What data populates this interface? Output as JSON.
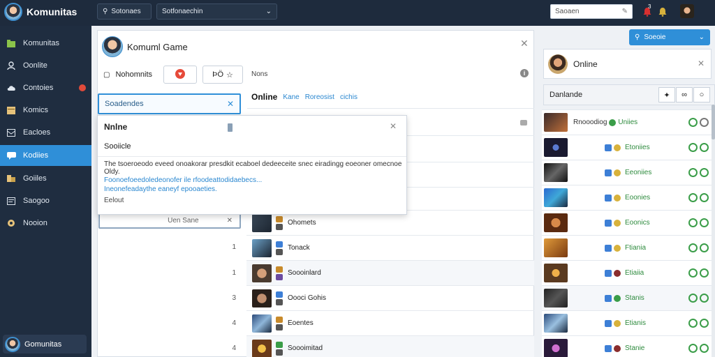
{
  "app": {
    "title": "Komunitas"
  },
  "topbar": {
    "search_label": "Sotonaes",
    "select_label": "Sotfonaechin",
    "input_value": "Saoaen",
    "notify_badge": "3",
    "colors": {
      "bg": "#1e2b3d",
      "accent": "#2f8fd8"
    }
  },
  "sidebar": {
    "items": [
      {
        "label": "Komunitas",
        "icon": "folder-icon"
      },
      {
        "label": "Oonlite",
        "icon": "user-icon"
      },
      {
        "label": "Contoies",
        "icon": "cloud-icon"
      },
      {
        "label": "Komics",
        "icon": "grid-icon"
      },
      {
        "label": "Eacloes",
        "icon": "inbox-icon"
      },
      {
        "label": "Kodiies",
        "icon": "chat-icon"
      },
      {
        "label": "Goiiles",
        "icon": "pin-icon"
      },
      {
        "label": "Saogoo",
        "icon": "doc-icon"
      },
      {
        "label": "Nooion",
        "icon": "gear-icon"
      }
    ],
    "user": "Gomunitas"
  },
  "main": {
    "title": "Komuml Game",
    "notice_label": "Nohomnits",
    "tool_label": "ÞÖ",
    "nons": "Nons",
    "tabs": [
      "Online",
      "Kane",
      "Roreosist",
      "cichis"
    ],
    "filter_value": "Soadendes",
    "popup": {
      "title": "Nnlne",
      "subtitle": "Sooiicle",
      "desc": "The tsoeroeodo eveed onoakorar presdkit ecaboel dedeeceite snec eiradingg eoeoner omecnoe Oldy.",
      "link1": "Foonoefoeedoledeonofer ile rfoodeattodidaebecs...",
      "link2": "Ineonefeadaythe eaneyf epooaeties.",
      "cancel": "Eelout"
    },
    "sub_button": "Uen Sane",
    "list": [
      {
        "num": "",
        "name": "Ohomets"
      },
      {
        "num": "1",
        "name": "Tonack"
      },
      {
        "num": "1",
        "name": "Soooinlard"
      },
      {
        "num": "3",
        "name": "Oooci Gohis"
      },
      {
        "num": "4",
        "name": "Eoentes"
      },
      {
        "num": "4",
        "name": "Soooimitad"
      }
    ]
  },
  "right": {
    "button_label": "Soeoie",
    "online_label": "Online",
    "dash_label": "Danlande",
    "rows": [
      {
        "name": "Rnooodiog",
        "status": "Uniies",
        "badge_color": "#3a9d48"
      },
      {
        "name": "",
        "status": "Etoniies",
        "badge_color": "#d8b23c"
      },
      {
        "name": "",
        "status": "Eeoniies",
        "badge_color": "#d8b23c"
      },
      {
        "name": "",
        "status": "Eoonies",
        "badge_color": "#d8b23c"
      },
      {
        "name": "",
        "status": "Eoonics",
        "badge_color": "#d8b23c"
      },
      {
        "name": "",
        "status": "Ftiania",
        "badge_color": "#d8b23c"
      },
      {
        "name": "",
        "status": "Etiaiia",
        "badge_color": "#8a2d2d"
      },
      {
        "name": "",
        "status": "Stanis",
        "badge_color": "#3a9d48"
      },
      {
        "name": "",
        "status": "Etianis",
        "badge_color": "#d8b23c"
      },
      {
        "name": "",
        "status": "Stanie",
        "badge_color": "#8a2d2d"
      }
    ]
  }
}
